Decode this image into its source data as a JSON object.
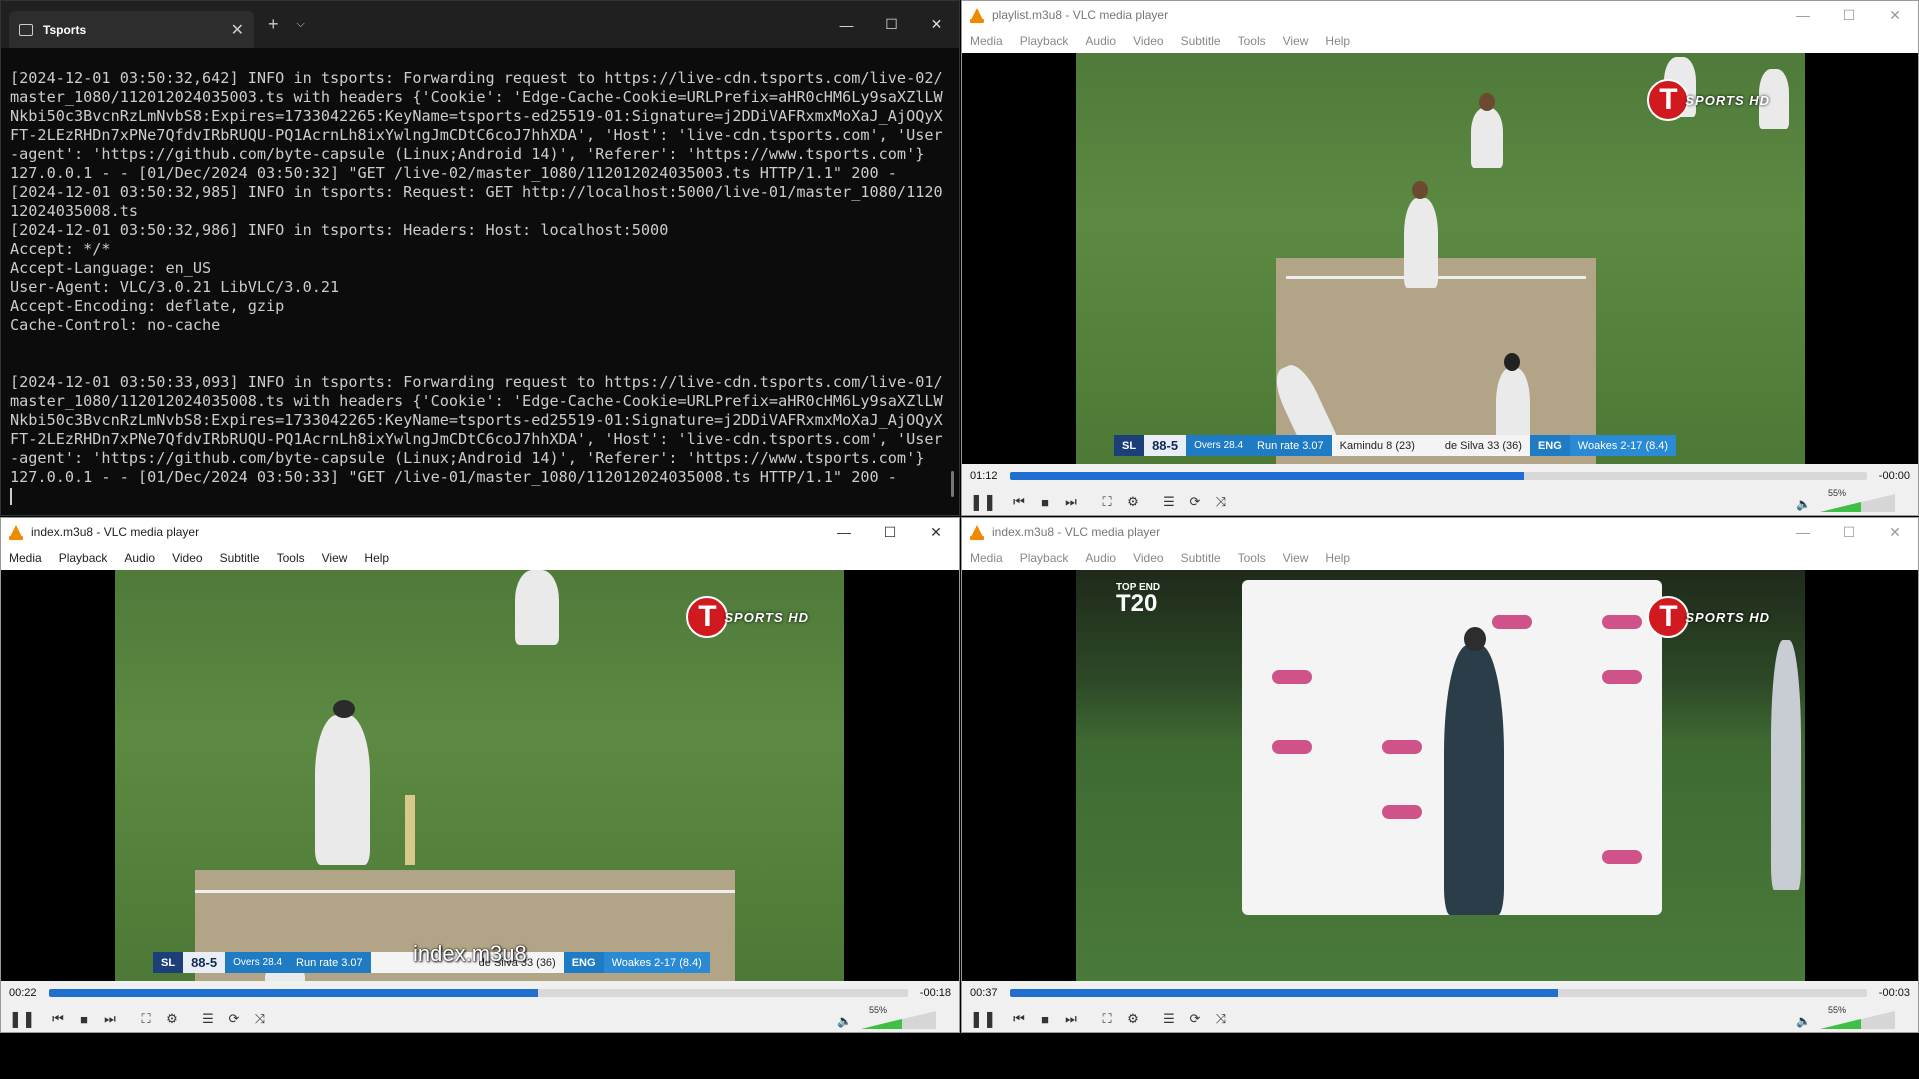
{
  "terminal": {
    "tab_title": "Tsports",
    "new_tab": "+",
    "tab_menu": "⌵",
    "lines": [
      "[2024-12-01 03:50:32,642] INFO in tsports: Forwarding request to https://live-cdn.tsports.com/live-02/",
      "master_1080/112012024035003.ts with headers {'Cookie': 'Edge-Cache-Cookie=URLPrefix=aHR0cHM6Ly9saXZlLW",
      "Nkbi50c3BvcnRzLmNvbS8:Expires=1733042265:KeyName=tsports-ed25519-01:Signature=j2DDiVAFRxmxMoXaJ_AjOQyX",
      "FT-2LEzRHDn7xPNe7QfdvIRbRUQU-PQ1AcrnLh8ixYwlngJmCDtC6coJ7hhXDA', 'Host': 'live-cdn.tsports.com', 'User",
      "-agent': 'https://github.com/byte-capsule (Linux;Android 14)', 'Referer': 'https://www.tsports.com'}",
      "127.0.0.1 - - [01/Dec/2024 03:50:32] \"GET /live-02/master_1080/112012024035003.ts HTTP/1.1\" 200 -",
      "[2024-12-01 03:50:32,985] INFO in tsports: Request: GET http://localhost:5000/live-01/master_1080/1120",
      "12024035008.ts",
      "[2024-12-01 03:50:32,986] INFO in tsports: Headers: Host: localhost:5000",
      "Accept: */*",
      "Accept-Language: en_US",
      "User-Agent: VLC/3.0.21 LibVLC/3.0.21",
      "Accept-Encoding: deflate, gzip",
      "Cache-Control: no-cache",
      "",
      "",
      "[2024-12-01 03:50:33,093] INFO in tsports: Forwarding request to https://live-cdn.tsports.com/live-01/",
      "master_1080/112012024035008.ts with headers {'Cookie': 'Edge-Cache-Cookie=URLPrefix=aHR0cHM6Ly9saXZlLW",
      "Nkbi50c3BvcnRzLmNvbS8:Expires=1733042265:KeyName=tsports-ed25519-01:Signature=j2DDiVAFRxmxMoXaJ_AjOQyX",
      "FT-2LEzRHDn7xPNe7QfdvIRbRUQU-PQ1AcrnLh8ixYwlngJmCDtC6coJ7hhXDA', 'Host': 'live-cdn.tsports.com', 'User",
      "-agent': 'https://github.com/byte-capsule (Linux;Android 14)', 'Referer': 'https://www.tsports.com'}",
      "127.0.0.1 - - [01/Dec/2024 03:50:33] \"GET /live-01/master_1080/112012024035008.ts HTTP/1.1\" 200 -"
    ]
  },
  "window_controls": {
    "minimize": "—",
    "maximize": "☐",
    "close": "✕"
  },
  "vlc_menu": [
    "Media",
    "Playback",
    "Audio",
    "Video",
    "Subtitle",
    "Tools",
    "View",
    "Help"
  ],
  "vlc_windows": [
    {
      "title": "playlist.m3u8 - VLC media player",
      "elapsed": "01:12",
      "remaining": "-00:00",
      "progress": 0.6,
      "volume": "55%"
    },
    {
      "title": "index.m3u8 - VLC media player",
      "elapsed": "00:22",
      "remaining": "-00:18",
      "progress": 0.57,
      "volume": "55%",
      "overlay": "index.m3u8"
    },
    {
      "title": "index.m3u8 - VLC media player",
      "elapsed": "00:37",
      "remaining": "-00:03",
      "progress": 0.64,
      "volume": "55%"
    }
  ],
  "broadcast": {
    "logo_letter": "T",
    "logo_text": "SPORTS HD",
    "team1": "SL",
    "score": "88-5",
    "overs": "Overs 28.4",
    "run_rate": "Run rate 3.07",
    "batter1": "Kamindu 8 (23)",
    "batter2": "de Silva 33 (36)",
    "team2": "ENG",
    "bowler": "Woakes 2-17 (8.4)",
    "topend_line1": "TOP END",
    "topend_line2": "T20"
  },
  "icons": {
    "pause": "❚❚",
    "prev": "⏮",
    "stop": "■",
    "next": "⏭",
    "fullscreen": "⛶",
    "extended": "⚙",
    "playlist": "☰",
    "loop": "⟳",
    "shuffle": "⤨",
    "speaker": "🔈"
  }
}
